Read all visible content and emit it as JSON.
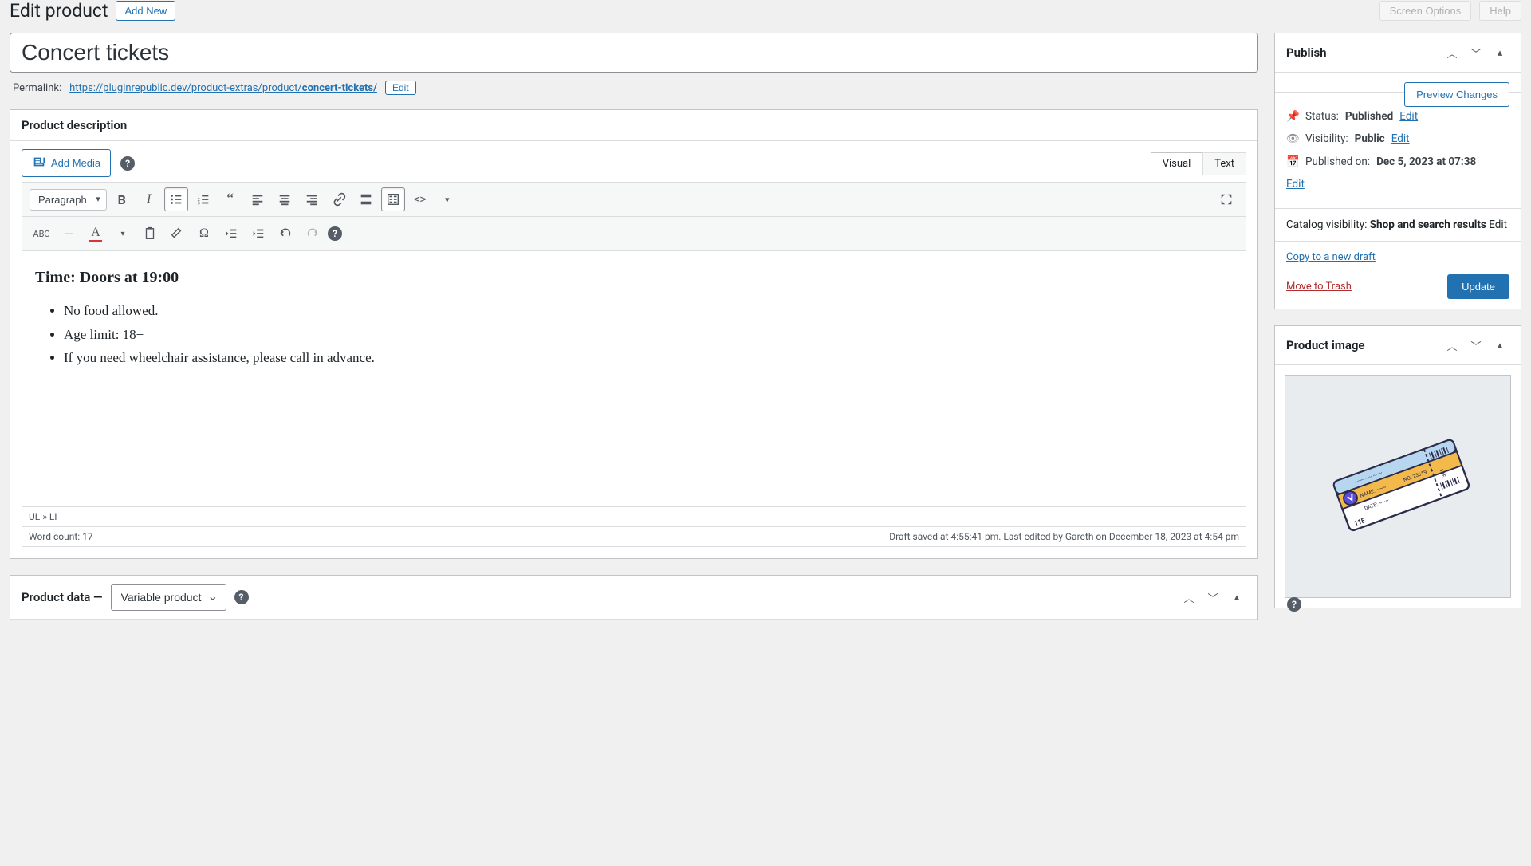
{
  "header": {
    "page_title": "Edit product",
    "add_new": "Add New",
    "screen_options": "Screen Options",
    "help": "Help"
  },
  "product": {
    "title": "Concert tickets",
    "permalink_label": "Permalink:",
    "permalink_base": "https://pluginrepublic.dev/product-extras/product/",
    "permalink_slug": "concert-tickets/",
    "permalink_edit": "Edit"
  },
  "description_box": {
    "title": "Product description",
    "add_media": "Add Media",
    "tabs": {
      "visual": "Visual",
      "text": "Text"
    },
    "format": "Paragraph",
    "content_heading": "Time: Doors at 19:00",
    "bullets": [
      "No food allowed.",
      "Age limit: 18+",
      "If you need wheelchair assistance, please call in advance."
    ],
    "path": "UL » LI",
    "word_count_label": "Word count: 17",
    "status": "Draft saved at 4:55:41 pm. Last edited by Gareth on December 18, 2023 at 4:54 pm"
  },
  "product_data": {
    "label": "Product data —",
    "type": "Variable product"
  },
  "publish": {
    "title": "Publish",
    "preview": "Preview Changes",
    "status_label": "Status:",
    "status_value": "Published",
    "visibility_label": "Visibility:",
    "visibility_value": "Public",
    "published_label": "Published on:",
    "published_value": "Dec 5, 2023 at 07:38",
    "catalog_label": "Catalog visibility:",
    "catalog_value": "Shop and search results",
    "edit": "Edit",
    "copy_draft": "Copy to a new draft",
    "trash": "Move to Trash",
    "update": "Update"
  },
  "product_image": {
    "title": "Product image"
  }
}
